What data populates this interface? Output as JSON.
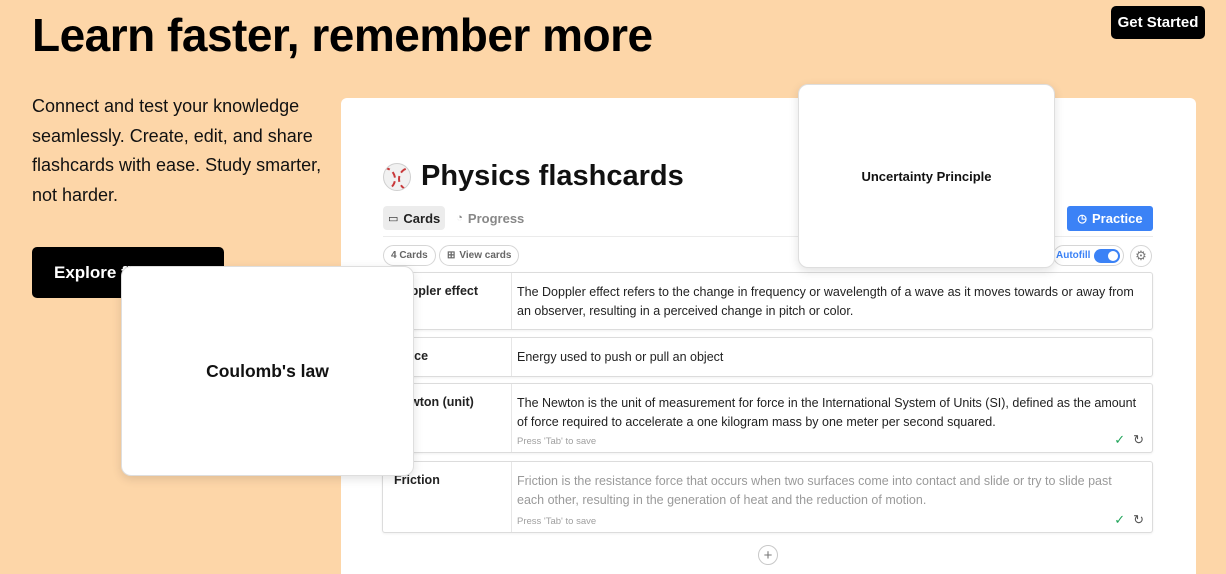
{
  "hero": {
    "title": "Learn faster, remember more",
    "description": "Connect and test your knowledge seamlessly. Create, edit, and share flashcards with ease. Study smarter, not harder.",
    "cta_label": "Explore flashcards",
    "get_started_label": "Get Started"
  },
  "deck": {
    "icon": "baseball-icon",
    "title": "Physics flashcards",
    "tabs": [
      {
        "label": "Cards",
        "icon": "cards-icon",
        "active": true
      },
      {
        "label": "Progress",
        "icon": "progress-icon",
        "active": false
      }
    ],
    "practice_label": "Practice",
    "card_count_label": "4 Cards",
    "view_cards_label": "View cards",
    "autofill_label": "Autofill",
    "autofill_on": true,
    "rows": [
      {
        "term": "Doppler effect",
        "definition": "The Doppler effect refers to the change in frequency or wavelength of a wave as it moves towards or away from an observer, resulting in a perceived change in pitch or color.",
        "hint": ""
      },
      {
        "term": "Force",
        "definition": "Energy used to push or pull an object",
        "hint": ""
      },
      {
        "term": "Newton (unit)",
        "definition": "The Newton is the unit of measurement for force in the International System of Units (SI), defined as the amount of force required to accelerate a one kilogram mass by one meter per second squared.",
        "hint": "Press 'Tab' to save"
      },
      {
        "term": "Friction",
        "definition": "Friction is the resistance force that occurs when two surfaces come into contact and slide or try to slide past each other, resulting in the generation of heat and the reduction of motion.",
        "hint": "Press 'Tab' to save"
      }
    ]
  },
  "floating_cards": {
    "top": "Uncertainty Principle",
    "left": "Coulomb's law"
  },
  "colors": {
    "background": "#fdd6a8",
    "accent": "#3b82f6",
    "button_dark": "#000000"
  }
}
